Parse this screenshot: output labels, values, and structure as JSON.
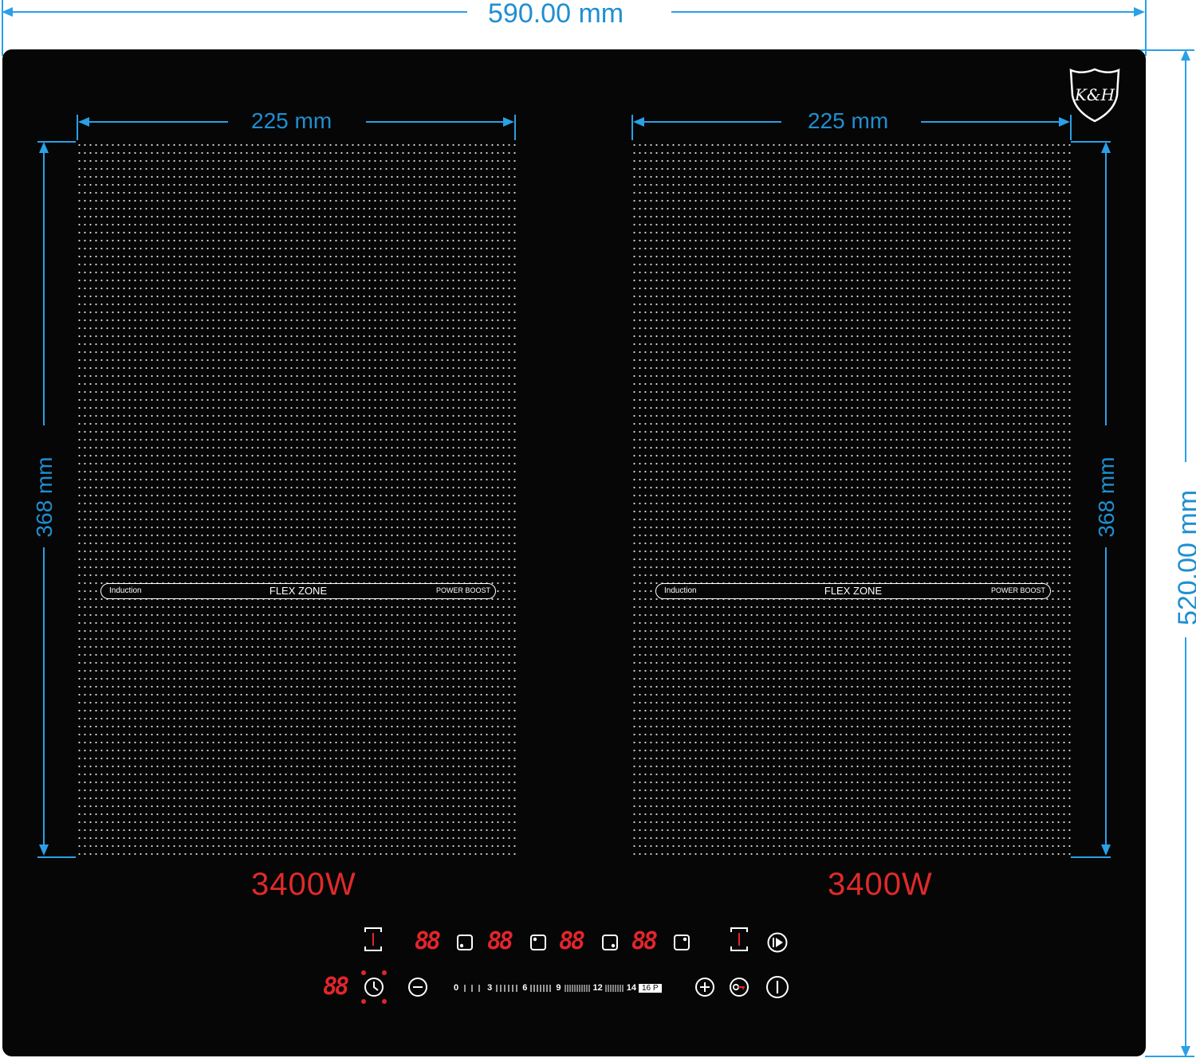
{
  "dimensions": {
    "width": "590.00 mm",
    "height": "520.00 mm",
    "left_zone_width": "225 mm",
    "left_zone_height": "368 mm",
    "right_zone_width": "225 mm",
    "right_zone_height": "368 mm"
  },
  "logo": {
    "text": "K&H"
  },
  "zones": [
    {
      "induction": "Induction",
      "flex": "FLEX ZONE",
      "boost": "POWER BOOST",
      "power": "3400W"
    },
    {
      "induction": "Induction",
      "flex": "FLEX ZONE",
      "boost": "POWER BOOST",
      "power": "3400W"
    }
  ],
  "controls": {
    "displays": [
      "88",
      "88",
      "88",
      "88"
    ],
    "timer_display": "88",
    "scale": {
      "marks": [
        "0",
        "3",
        "6",
        "9",
        "12",
        "14"
      ],
      "boost": "16 P"
    },
    "icons": [
      "flex-zone-left-icon",
      "zone-select-icon",
      "flex-zone-right-icon",
      "pause-play-icon",
      "timer-icon",
      "minus-icon",
      "plus-icon",
      "key-lock-icon",
      "power-icon"
    ]
  },
  "colors": {
    "dimension": "#2aa0e6",
    "glass": "#060606",
    "display_red": "#e3252b"
  }
}
